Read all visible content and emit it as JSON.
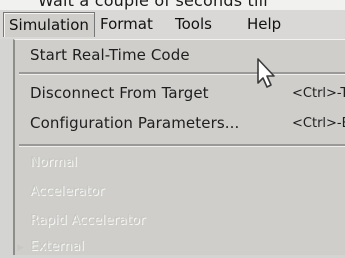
{
  "top_partial_text": "Wait a couple of seconds till",
  "menubar": {
    "items": [
      {
        "label": "Simulation",
        "active": true
      },
      {
        "label": "Format",
        "active": false
      },
      {
        "label": "Tools",
        "active": false
      },
      {
        "label": "Help",
        "active": false
      }
    ]
  },
  "dropdown": {
    "items": [
      {
        "label": "Start Real-Time Code",
        "shortcut": ""
      },
      {
        "label": "Disconnect From Target",
        "shortcut": "<Ctrl>-T"
      },
      {
        "label": "Configuration Parameters...",
        "shortcut": "<Ctrl>-E"
      }
    ],
    "disabled_items": [
      {
        "label": "Normal"
      },
      {
        "label": "Accelerator"
      },
      {
        "label": "Rapid Accelerator"
      },
      {
        "label": "External"
      }
    ]
  },
  "icons": [
    "mouse-cursor-icon",
    "checkmark-icon"
  ]
}
